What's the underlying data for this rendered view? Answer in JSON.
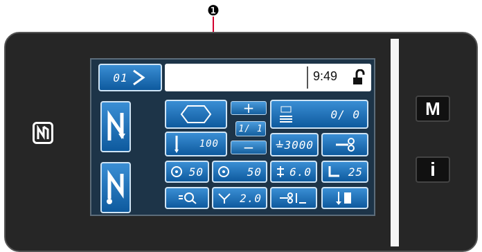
{
  "callout": {
    "number": "❶"
  },
  "header": {
    "pattern_no": "01",
    "time": "9:49",
    "lock_icon": "unlocked-padlock-icon"
  },
  "buttons": {
    "tack_up": "+",
    "tack_down": "−",
    "count_value": "1/ 1",
    "stitch_value": "100",
    "counter_value": "0/ 0",
    "speed_value": "3000",
    "needle_thread_left": "50",
    "needle_thread_right": "50",
    "stitch_length": "6.0",
    "presser": "25",
    "thread_tension": "2.0"
  },
  "hardware": {
    "m_label": "M",
    "i_label": "i"
  },
  "colors": {
    "panel": "#262626",
    "screen": "#1d3448",
    "button_blue": "#1a6db5"
  }
}
